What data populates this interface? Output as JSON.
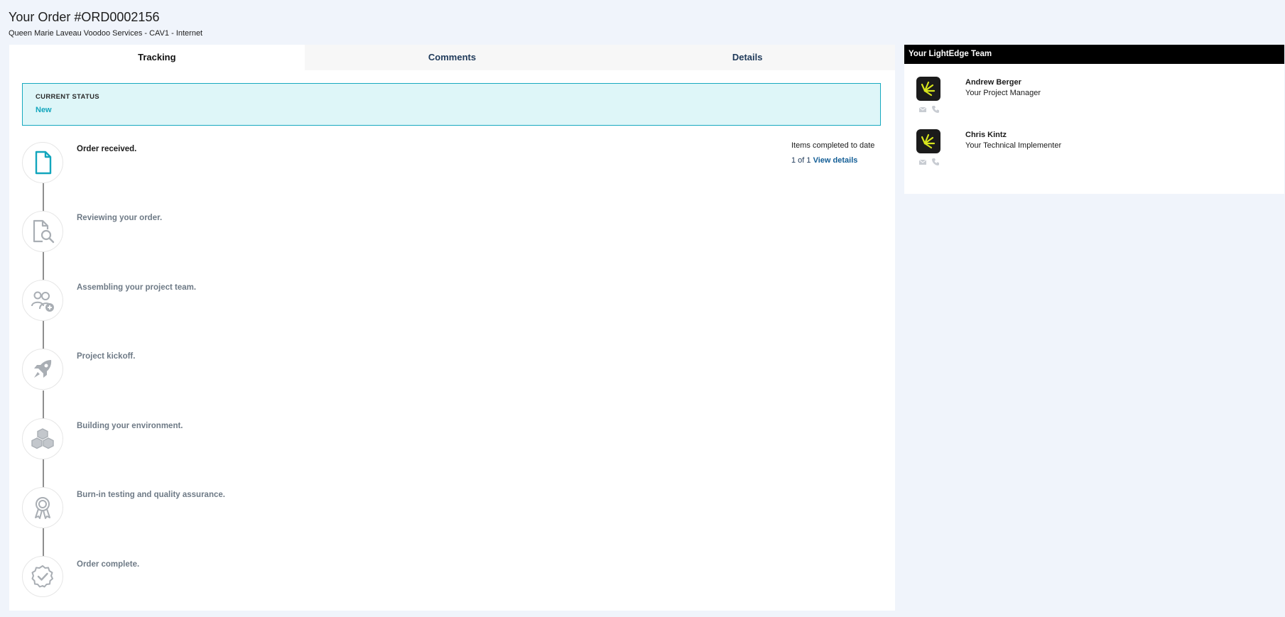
{
  "header": {
    "title": "Your Order #ORD0002156",
    "subtitle": "Queen Marie Laveau Voodoo Services - CAV1 - Internet"
  },
  "tabs": [
    {
      "label": "Tracking"
    },
    {
      "label": "Comments"
    },
    {
      "label": "Details"
    }
  ],
  "status": {
    "label": "CURRENT STATUS",
    "value": "New"
  },
  "steps": [
    {
      "label": "Order received.",
      "icon": "document-icon",
      "done": true
    },
    {
      "label": "Reviewing your order.",
      "icon": "document-search-icon",
      "done": false
    },
    {
      "label": "Assembling your project team.",
      "icon": "team-add-icon",
      "done": false
    },
    {
      "label": "Project kickoff.",
      "icon": "rocket-icon",
      "done": false
    },
    {
      "label": "Building your environment.",
      "icon": "cubes-icon",
      "done": false
    },
    {
      "label": "Burn-in testing and quality assurance.",
      "icon": "award-ribbon-icon",
      "done": false
    },
    {
      "label": "Order complete.",
      "icon": "check-badge-icon",
      "done": false
    }
  ],
  "items_completed": {
    "label": "Items completed to date",
    "count": "1 of 1",
    "link": "View details"
  },
  "team": {
    "header": "Your LightEdge Team",
    "members": [
      {
        "name": "Andrew Berger",
        "role": "Your Project Manager"
      },
      {
        "name": "Chris Kintz",
        "role": "Your Technical Implementer"
      }
    ]
  },
  "colors": {
    "accent": "#12a6bd",
    "status_bg": "#def6f8",
    "page_bg": "#f0f4fb",
    "logo_yellow": "#d7e51c"
  }
}
